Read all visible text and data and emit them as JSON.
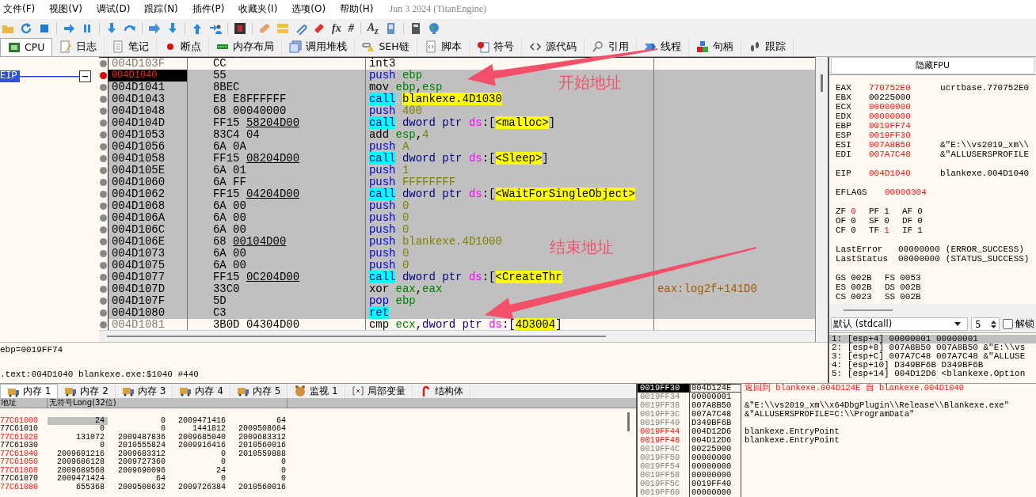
{
  "menu": [
    {
      "label": "文件(F)"
    },
    {
      "label": "视图(V)"
    },
    {
      "label": "调试(D)"
    },
    {
      "label": "跟踪(N)"
    },
    {
      "label": "插件(P)"
    },
    {
      "label": "收藏夹(I)"
    },
    {
      "label": "选项(O)"
    },
    {
      "label": "帮助(H)"
    }
  ],
  "build_info": "Jun 3 2024 (TitanEngine)",
  "toolbar_glyphs": [
    "fx",
    "#",
    "A$_{z}$"
  ],
  "tabs": [
    {
      "label": "CPU",
      "selected": true
    },
    {
      "label": "日志",
      "selected": false
    },
    {
      "label": "笔记",
      "selected": false
    },
    {
      "label": "断点",
      "selected": false
    },
    {
      "label": "内存布局",
      "selected": false
    },
    {
      "label": "调用堆栈",
      "selected": false
    },
    {
      "label": "SEH链",
      "selected": false
    },
    {
      "label": "脚本",
      "selected": false
    },
    {
      "label": "符号",
      "selected": false
    },
    {
      "label": "源代码",
      "selected": false
    },
    {
      "label": "引用",
      "selected": false
    },
    {
      "label": "线程",
      "selected": false
    },
    {
      "label": "句柄",
      "selected": false
    },
    {
      "label": "跟踪",
      "selected": false
    }
  ],
  "eip_label": "EIP",
  "disassembly": [
    {
      "address": "004D103F",
      "bytes": "CC",
      "selected": false,
      "eip": false,
      "breakpoint": false,
      "tokens": [
        {
          "text": "int3",
          "kind": "op"
        }
      ]
    },
    {
      "address": "004D1040",
      "bytes": "55",
      "selected": true,
      "eip": true,
      "breakpoint": true,
      "tokens": [
        {
          "text": "push",
          "kind": "stack"
        },
        {
          "text": " ebp",
          "kind": "reg"
        }
      ]
    },
    {
      "address": "004D1041",
      "bytes": "8BEC",
      "selected": true,
      "eip": false,
      "breakpoint": false,
      "tokens": [
        {
          "text": "mov",
          "kind": "op"
        },
        {
          "text": " ebp",
          "kind": "reg"
        },
        {
          "text": ",",
          "kind": "punct"
        },
        {
          "text": "esp",
          "kind": "reg"
        }
      ]
    },
    {
      "address": "004D1043",
      "bytes": "E8 E8FFFFFF",
      "selected": true,
      "eip": false,
      "breakpoint": false,
      "tokens": [
        {
          "text": "call",
          "kind": "call"
        },
        {
          "text": "blankexe.4D1030",
          "kind": "label"
        }
      ]
    },
    {
      "address": "004D1048",
      "bytes": "68 00040000",
      "selected": true,
      "eip": false,
      "breakpoint": false,
      "tokens": [
        {
          "text": "push",
          "kind": "stack"
        },
        {
          "text": " 400",
          "kind": "num"
        }
      ]
    },
    {
      "address": "004D104D",
      "bytes": "FF15",
      "ref": "58204D00",
      "selected": true,
      "eip": false,
      "breakpoint": false,
      "tokens": [
        {
          "text": "call",
          "kind": "call"
        },
        {
          "text": " dword ptr",
          "kind": "ptr"
        },
        {
          "text": " ds",
          "kind": "seg"
        },
        {
          "text": ":[",
          "kind": "punct"
        },
        {
          "text": "<malloc>",
          "kind": "label"
        },
        {
          "text": "]",
          "kind": "punct"
        }
      ]
    },
    {
      "address": "004D1053",
      "bytes": "83C4 04",
      "selected": true,
      "eip": false,
      "breakpoint": false,
      "tokens": [
        {
          "text": "add",
          "kind": "op"
        },
        {
          "text": " esp",
          "kind": "reg"
        },
        {
          "text": ",",
          "kind": "punct"
        },
        {
          "text": "4",
          "kind": "num"
        }
      ]
    },
    {
      "address": "004D1056",
      "bytes": "6A 0A",
      "selected": true,
      "eip": false,
      "breakpoint": false,
      "tokens": [
        {
          "text": "push",
          "kind": "stack"
        },
        {
          "text": " A",
          "kind": "num"
        }
      ]
    },
    {
      "address": "004D1058",
      "bytes": "FF15",
      "ref": "08204D00",
      "selected": true,
      "eip": false,
      "breakpoint": false,
      "tokens": [
        {
          "text": "call",
          "kind": "call"
        },
        {
          "text": " dword ptr",
          "kind": "ptr"
        },
        {
          "text": " ds",
          "kind": "seg"
        },
        {
          "text": ":[",
          "kind": "punct"
        },
        {
          "text": "<Sleep>",
          "kind": "label"
        },
        {
          "text": "]",
          "kind": "punct"
        }
      ]
    },
    {
      "address": "004D105E",
      "bytes": "6A 01",
      "selected": true,
      "eip": false,
      "breakpoint": false,
      "tokens": [
        {
          "text": "push",
          "kind": "stack"
        },
        {
          "text": " 1",
          "kind": "num"
        }
      ]
    },
    {
      "address": "004D1060",
      "bytes": "6A FF",
      "selected": true,
      "eip": false,
      "breakpoint": false,
      "tokens": [
        {
          "text": "push",
          "kind": "stack"
        },
        {
          "text": " FFFFFFFF",
          "kind": "num"
        }
      ]
    },
    {
      "address": "004D1062",
      "bytes": "FF15",
      "ref": "04204D00",
      "selected": true,
      "eip": false,
      "breakpoint": false,
      "tokens": [
        {
          "text": "call",
          "kind": "call"
        },
        {
          "text": " dword ptr",
          "kind": "ptr"
        },
        {
          "text": " ds",
          "kind": "seg"
        },
        {
          "text": ":[",
          "kind": "punct"
        },
        {
          "text": "<WaitForSingleObject>",
          "kind": "label"
        }
      ]
    },
    {
      "address": "004D1068",
      "bytes": "6A 00",
      "selected": true,
      "eip": false,
      "breakpoint": false,
      "tokens": [
        {
          "text": "push",
          "kind": "stack"
        },
        {
          "text": " 0",
          "kind": "num"
        }
      ]
    },
    {
      "address": "004D106A",
      "bytes": "6A 00",
      "selected": true,
      "eip": false,
      "breakpoint": false,
      "tokens": [
        {
          "text": "push",
          "kind": "stack"
        },
        {
          "text": " 0",
          "kind": "num"
        }
      ]
    },
    {
      "address": "004D106C",
      "bytes": "6A 00",
      "selected": true,
      "eip": false,
      "breakpoint": false,
      "tokens": [
        {
          "text": "push",
          "kind": "stack"
        },
        {
          "text": " 0",
          "kind": "num"
        }
      ]
    },
    {
      "address": "004D106E",
      "bytes": "68",
      "ref": "00104D00",
      "selected": true,
      "eip": false,
      "breakpoint": false,
      "tokens": [
        {
          "text": "push",
          "kind": "stack"
        },
        {
          "text": " blankexe.4D1000",
          "kind": "num"
        }
      ]
    },
    {
      "address": "004D1073",
      "bytes": "6A 00",
      "selected": true,
      "eip": false,
      "breakpoint": false,
      "tokens": [
        {
          "text": "push",
          "kind": "stack"
        },
        {
          "text": " 0",
          "kind": "num"
        }
      ]
    },
    {
      "address": "004D1075",
      "bytes": "6A 00",
      "selected": true,
      "eip": false,
      "breakpoint": false,
      "tokens": [
        {
          "text": "push",
          "kind": "stack"
        },
        {
          "text": " 0",
          "kind": "num"
        }
      ]
    },
    {
      "address": "004D1077",
      "bytes": "FF15",
      "ref": "0C204D00",
      "selected": true,
      "eip": false,
      "breakpoint": false,
      "tokens": [
        {
          "text": "call",
          "kind": "call"
        },
        {
          "text": " dword ptr",
          "kind": "ptr"
        },
        {
          "text": " ds",
          "kind": "seg"
        },
        {
          "text": ":[",
          "kind": "punct"
        },
        {
          "text": "<CreateThr",
          "kind": "label"
        }
      ]
    },
    {
      "address": "004D107D",
      "bytes": "33C0",
      "selected": true,
      "eip": false,
      "breakpoint": false,
      "tokens": [
        {
          "text": "xor",
          "kind": "op"
        },
        {
          "text": " eax",
          "kind": "reg"
        },
        {
          "text": ",",
          "kind": "punct"
        },
        {
          "text": "eax",
          "kind": "reg"
        }
      ],
      "comment": "eax:log2f+141D0"
    },
    {
      "address": "004D107F",
      "bytes": "5D",
      "selected": true,
      "eip": false,
      "breakpoint": false,
      "tokens": [
        {
          "text": "pop",
          "kind": "stack"
        },
        {
          "text": " ebp",
          "kind": "reg"
        }
      ]
    },
    {
      "address": "004D1080",
      "bytes": "C3",
      "selected": true,
      "eip": false,
      "breakpoint": false,
      "tokens": [
        {
          "text": "ret",
          "kind": "call"
        }
      ]
    },
    {
      "address": "004D1081",
      "bytes": "3B0D 04304D00",
      "selected": false,
      "eip": false,
      "breakpoint": false,
      "tokens": [
        {
          "text": "cmp",
          "kind": "op"
        },
        {
          "text": " ecx",
          "kind": "reg"
        },
        {
          "text": ",",
          "kind": "punct"
        },
        {
          "text": "dword ptr",
          "kind": "ptr"
        },
        {
          "text": " ds",
          "kind": "seg"
        },
        {
          "text": ":[",
          "kind": "punct"
        },
        {
          "text": "4D3004",
          "kind": "label"
        },
        {
          "text": "]",
          "kind": "punct"
        }
      ]
    }
  ],
  "annotations": [
    {
      "text": "开始地址"
    },
    {
      "text": "结束地址"
    }
  ],
  "info_lines": [
    "ebp=0019FF74",
    ".text:004D1040 blankexe.exe:$1040 #440"
  ],
  "fpu_button": "隐藏FPU",
  "register_groups": [
    [
      {
        "name": "EAX",
        "value": "770752E0",
        "changed": true,
        "comment": "ucrtbase.770752E0"
      },
      {
        "name": "EBX",
        "value": "00225000",
        "changed": false
      },
      {
        "name": "ECX",
        "value": "00000000",
        "changed": true
      },
      {
        "name": "EDX",
        "value": "00000000",
        "changed": true
      },
      {
        "name": "EBP",
        "value": "0019FF74",
        "changed": true
      },
      {
        "name": "ESP",
        "value": "0019FF30",
        "changed": true
      },
      {
        "name": "ESI",
        "value": "007A8B50",
        "changed": true,
        "comment": "&\"E:\\\\vs2019_xm\\\\"
      },
      {
        "name": "EDI",
        "value": "007A7C48",
        "changed": true,
        "comment": "&\"ALLUSERSPROFILE"
      }
    ],
    [
      {
        "name": "EIP",
        "value": "004D1040",
        "changed": true,
        "comment": "blankexe.004D1040"
      }
    ]
  ],
  "eflags": {
    "name": "EFLAGS",
    "value": "00000304",
    "changed": true
  },
  "flags": [
    [
      {
        "name": "ZF",
        "value": "0",
        "changed": true
      },
      {
        "name": "PF",
        "value": "1",
        "changed": false
      },
      {
        "name": "AF",
        "value": "0",
        "changed": false
      }
    ],
    [
      {
        "name": "OF",
        "value": "0",
        "changed": false
      },
      {
        "name": "SF",
        "value": "0",
        "changed": false
      },
      {
        "name": "DF",
        "value": "0",
        "changed": false
      }
    ],
    [
      {
        "name": "CF",
        "value": "0",
        "changed": false
      },
      {
        "name": "TF",
        "value": "1",
        "changed": true
      },
      {
        "name": "IF",
        "value": "1",
        "changed": false
      }
    ]
  ],
  "last_status": [
    {
      "name": "LastError",
      "value": "00000000",
      "comment": "(ERROR_SUCCESS)"
    },
    {
      "name": "LastStatus",
      "value": "00000000",
      "comment": "(STATUS_SUCCESS)"
    }
  ],
  "segments": [
    [
      {
        "name": "GS",
        "value": "002B"
      },
      {
        "name": "FS",
        "value": "0053"
      }
    ],
    [
      {
        "name": "ES",
        "value": "002B"
      },
      {
        "name": "DS",
        "value": "002B"
      }
    ],
    [
      {
        "name": "CS",
        "value": "0023"
      },
      {
        "name": "SS",
        "value": "002B"
      }
    ]
  ],
  "call_convention": {
    "value": "默认 (stdcall)"
  },
  "arg_count": {
    "value": "5"
  },
  "unlock": {
    "label": "解锁",
    "checked": false
  },
  "arguments": [
    {
      "text": "1: [esp+4] 00000001 00000001",
      "selected": true
    },
    {
      "text": "2: [esp+8] 007A8B50 007A8B50 &\"E:\\\\vs",
      "selected": false
    },
    {
      "text": "3: [esp+C] 007A7C48 007A7C48 &\"ALLUSE",
      "selected": false
    },
    {
      "text": "4: [esp+10] D349BF6B D349BF6B",
      "selected": false
    },
    {
      "text": "5: [esp+14] 004D12D6 <blankexe.Option",
      "selected": false
    }
  ],
  "bottom_tabs": [
    {
      "label": "内存 1",
      "selected": true
    },
    {
      "label": "内存 2",
      "selected": false
    },
    {
      "label": "内存 3",
      "selected": false
    },
    {
      "label": "内存 4",
      "selected": false
    },
    {
      "label": "内存 5",
      "selected": false
    },
    {
      "label": "监视 1",
      "selected": false
    },
    {
      "label": "局部变量",
      "selected": false
    },
    {
      "label": "结构体",
      "selected": false
    }
  ],
  "dump": {
    "columns": [
      "地址",
      "无符号Long(32位)"
    ],
    "rows": [
      {
        "address": "77C61000",
        "changed": true,
        "values": [
          "24",
          "0",
          "2009471416",
          "64"
        ]
      },
      {
        "address": "77C61010",
        "changed": false,
        "values": [
          "0",
          "0",
          "1441812",
          "2009508664"
        ]
      },
      {
        "address": "77C61020",
        "changed": true,
        "values": [
          "131072",
          "2009487836",
          "2009685040",
          "2009683312"
        ]
      },
      {
        "address": "77C61030",
        "changed": false,
        "values": [
          "0",
          "2010555824",
          "2009916416",
          "2010560016"
        ]
      },
      {
        "address": "77C61040",
        "changed": true,
        "values": [
          "2009691216",
          "2009683312",
          "0",
          "2010559888"
        ]
      },
      {
        "address": "77C61050",
        "changed": true,
        "values": [
          "2009686128",
          "2009727360",
          "0",
          "0"
        ]
      },
      {
        "address": "77C61060",
        "changed": true,
        "values": [
          "2009689568",
          "2009690096",
          "24",
          "0"
        ]
      },
      {
        "address": "77C61070",
        "changed": false,
        "values": [
          "2009471424",
          "64",
          "0",
          "0"
        ]
      },
      {
        "address": "77C61080",
        "changed": true,
        "values": [
          "655368",
          "2009508632",
          "2009726384",
          "2010560016"
        ]
      }
    ]
  },
  "stack": [
    {
      "address": "0019FF30",
      "value": "004D124E",
      "selected": true,
      "changed": false,
      "comment": "返回到 blankexe.004D124E 自 blankexe.004D1040",
      "return": true
    },
    {
      "address": "0019FF34",
      "value": "00000001",
      "selected": false,
      "changed": false
    },
    {
      "address": "0019FF38",
      "value": "007A8B50",
      "selected": false,
      "changed": false,
      "comment": "&\"E:\\\\vs2019_xm\\\\x64DbgPlugin\\\\Release\\\\Blankexe.exe\"",
      "return": false
    },
    {
      "address": "0019FF3C",
      "value": "007A7C48",
      "selected": false,
      "changed": false,
      "comment": "&\"ALLUSERSPROFILE=C:\\\\ProgramData\"",
      "return": false
    },
    {
      "address": "0019FF40",
      "value": "D349BF6B",
      "selected": false,
      "changed": false
    },
    {
      "address": "0019FF44",
      "value": "004D12D6",
      "selected": false,
      "changed": true,
      "comment": "blankexe.EntryPoint",
      "return": false
    },
    {
      "address": "0019FF48",
      "value": "004D12D6",
      "selected": false,
      "changed": true,
      "comment": "blankexe.EntryPoint",
      "return": false
    },
    {
      "address": "0019FF4C",
      "value": "00225000",
      "selected": false,
      "changed": false
    },
    {
      "address": "0019FF50",
      "value": "00000000",
      "selected": false,
      "changed": false
    },
    {
      "address": "0019FF54",
      "value": "00000000",
      "selected": false,
      "changed": false
    },
    {
      "address": "0019FF58",
      "value": "00000000",
      "selected": false,
      "changed": false
    },
    {
      "address": "0019FF5C",
      "value": "0019FF40",
      "selected": false,
      "changed": false
    },
    {
      "address": "0019FF60",
      "value": "00000000",
      "selected": false,
      "changed": false
    }
  ]
}
